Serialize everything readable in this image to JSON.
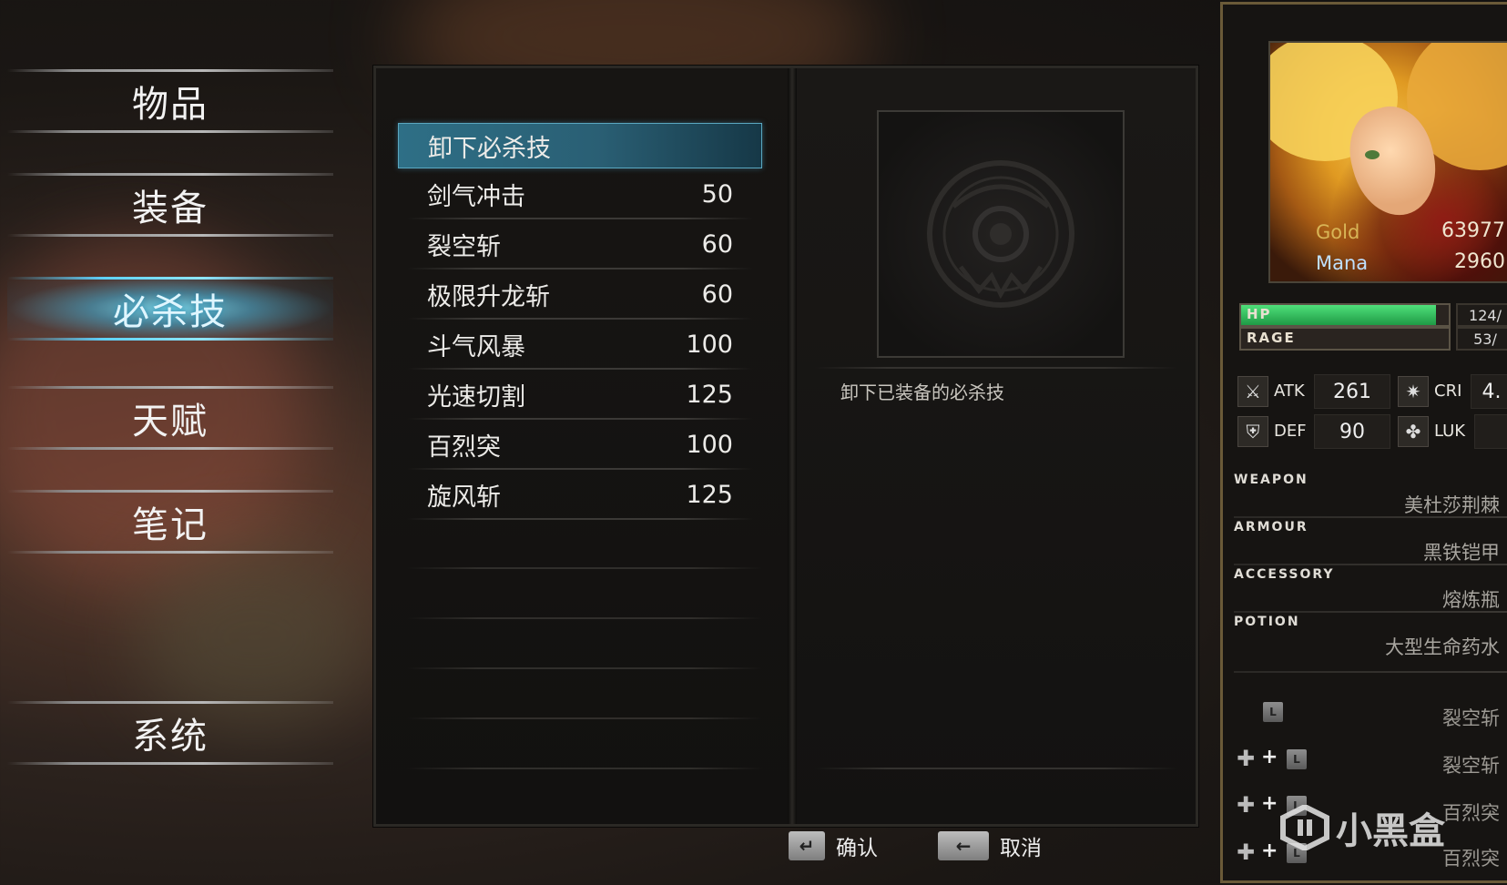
{
  "menu": [
    {
      "label": "物品",
      "active": false
    },
    {
      "label": "装备",
      "active": false
    },
    {
      "label": "必杀技",
      "active": true
    },
    {
      "label": "天赋",
      "active": false
    },
    {
      "label": "笔记",
      "active": false
    },
    {
      "label": "系统",
      "active": false
    }
  ],
  "skills": [
    {
      "name": "卸下必杀技",
      "cost": ""
    },
    {
      "name": "剑气冲击",
      "cost": "50"
    },
    {
      "name": "裂空斩",
      "cost": "60"
    },
    {
      "name": "极限升龙斩",
      "cost": "60"
    },
    {
      "name": "斗气风暴",
      "cost": "100"
    },
    {
      "name": "光速切割",
      "cost": "125"
    },
    {
      "name": "百烈突",
      "cost": "100"
    },
    {
      "name": "旋风斩",
      "cost": "125"
    }
  ],
  "detail": {
    "description": "卸下已装备的必杀技"
  },
  "hints": {
    "confirm": "确认",
    "cancel": "取消"
  },
  "character": {
    "gold_label": "Gold",
    "gold": "63977",
    "mana_label": "Mana",
    "mana": "2960",
    "hp_label": "HP",
    "hp_value": "124/",
    "hp_fraction": 0.94,
    "rage_label": "RAGE",
    "rage_value": "53/",
    "rage_fraction": 0.0,
    "atk_label": "ATK",
    "atk": "261",
    "cri_label": "CRI",
    "cri": "4.",
    "def_label": "DEF",
    "def": "90",
    "luk_label": "LUK",
    "luk": "",
    "weapon_label": "WEAPON",
    "weapon": "美杜莎荆棘",
    "armour_label": "ARMOUR",
    "armour": "黑铁铠甲",
    "accessory_label": "ACCESSORY",
    "accessory": "熔炼瓶",
    "potion_label": "POTION",
    "potion": "大型生命药水",
    "combo1": "裂空斩",
    "combo2": "裂空斩",
    "combo3": "百烈突",
    "combo4": "百烈突"
  },
  "watermark": "小黑盒"
}
